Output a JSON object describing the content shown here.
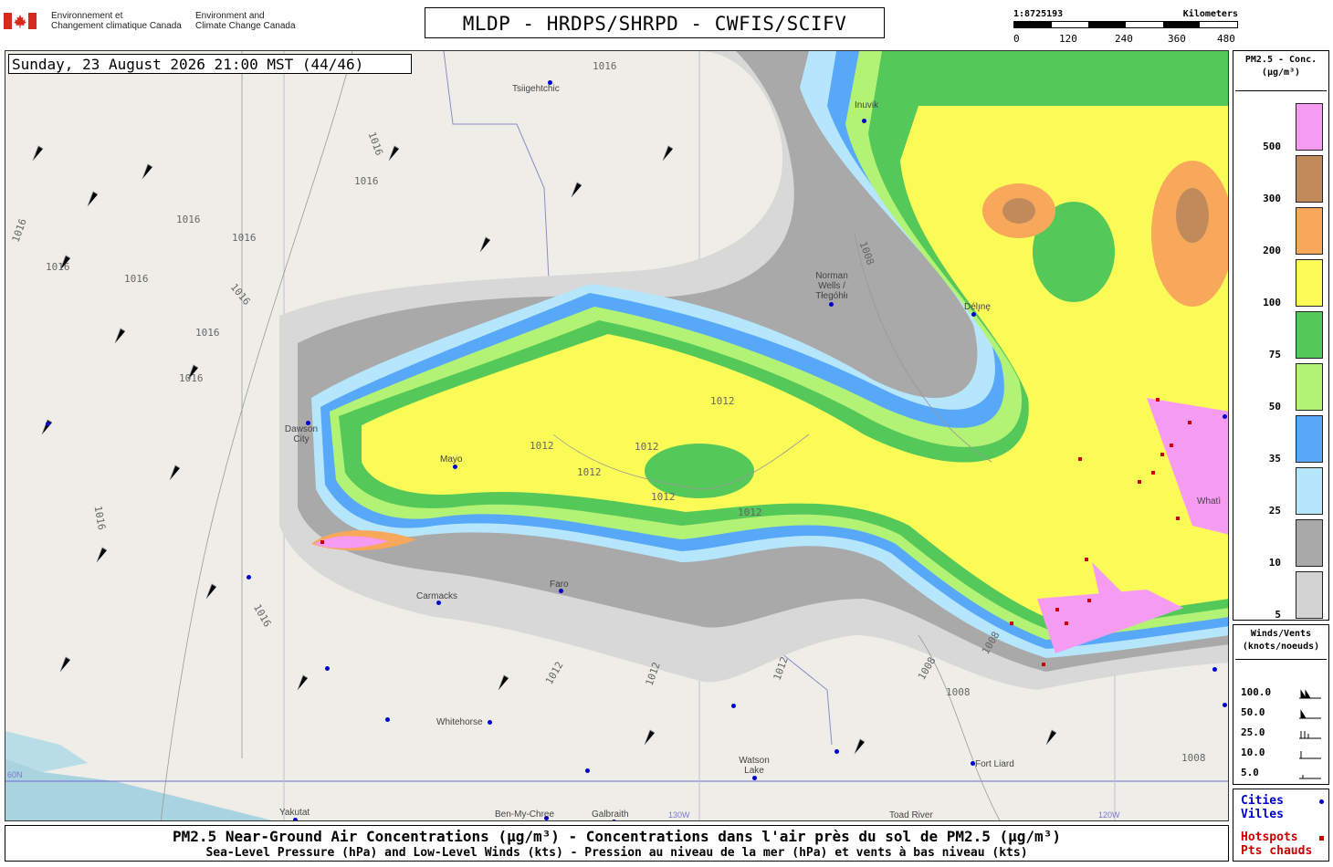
{
  "header": {
    "govt_fr_line1": "Environnement et",
    "govt_fr_line2": "Changement climatique Canada",
    "govt_en_line1": "Environment and",
    "govt_en_line2": "Climate Change Canada",
    "title": "MLDP - HRDPS/SHRPD - CWFIS/SCIFV"
  },
  "scale": {
    "ratio": "1:8725193",
    "unit": "Kilometers",
    "ticks": [
      "0",
      "120",
      "240",
      "360",
      "480"
    ]
  },
  "map": {
    "timestamp": "Sunday, 23 August 2026 21:00 MST (44/46)",
    "cities": [
      {
        "name": "Tsiigehtchic",
        "color": "#0000cc"
      },
      {
        "name": "Inuvik",
        "color": "#0000cc"
      },
      {
        "name": "Norman Wells / Tłegóhłı",
        "color": "#0000cc"
      },
      {
        "name": "Délı̨nę",
        "color": "#0000cc"
      },
      {
        "name": "Dawson City",
        "color": "#0000cc"
      },
      {
        "name": "Mayo",
        "color": "#0000cc"
      },
      {
        "name": "Carmacks",
        "color": "#0000cc"
      },
      {
        "name": "Faro",
        "color": "#0000cc"
      },
      {
        "name": "Whitehorse",
        "color": "#0000cc"
      },
      {
        "name": "Watson Lake",
        "color": "#0000cc"
      },
      {
        "name": "Fort Liard",
        "color": "#0000cc"
      },
      {
        "name": "Whatì",
        "color": "#0000cc"
      },
      {
        "name": "Yakutat",
        "color": "#0000cc"
      },
      {
        "name": "Ben-My-Chree",
        "color": "#0000cc"
      },
      {
        "name": "Galbraith",
        "color": "#0000cc"
      },
      {
        "name": "Toad River",
        "color": "#0000cc"
      }
    ],
    "isobar_labels": [
      "1016",
      "1016",
      "1016",
      "1016",
      "1016",
      "1016",
      "1016",
      "1016",
      "1016",
      "1016",
      "1016",
      "1012",
      "1012",
      "1012",
      "1012",
      "1012",
      "1012",
      "1012",
      "1008",
      "1008",
      "1008",
      "1008",
      "1008",
      "1012",
      "1012",
      "1016",
      "1016"
    ],
    "lon_labels": [
      "130W",
      "120W",
      "60N"
    ]
  },
  "legend": {
    "title_line1": "PM2.5 - Conc.",
    "title_line2": "(µg/m³)",
    "bins": [
      {
        "label": "500",
        "color": "#f59cf2"
      },
      {
        "label": "300",
        "color": "#c08a5a"
      },
      {
        "label": "200",
        "color": "#f7a85a"
      },
      {
        "label": "100",
        "color": "#fbfb58"
      },
      {
        "label": "75",
        "color": "#55c85a"
      },
      {
        "label": "50",
        "color": "#b2f274"
      },
      {
        "label": "35",
        "color": "#58a8fa"
      },
      {
        "label": "25",
        "color": "#b6e6fb"
      },
      {
        "label": "10",
        "color": "#a9a9a9"
      },
      {
        "label": "5",
        "color": "#d3d3d3"
      }
    ]
  },
  "winds": {
    "title_line1": "Winds/Vents",
    "title_line2": "(knots/noeuds)",
    "rows": [
      "100.0",
      "50.0",
      "25.0",
      "10.0",
      "5.0"
    ]
  },
  "symbols": {
    "cities_en": "Cities",
    "cities_fr": "Villes",
    "hotspots_en": "Hotspots",
    "hotspots_fr": "Pts chauds"
  },
  "caption": {
    "line1": "PM2.5 Near-Ground Air Concentrations (µg/m³) - Concentrations dans l'air près du sol de PM2.5 (µg/m³)",
    "line2": "Sea-Level Pressure (hPa) and Low-Level Winds (kts) - Pression au niveau de la mer (hPa) et vents à bas niveau (kts)"
  }
}
